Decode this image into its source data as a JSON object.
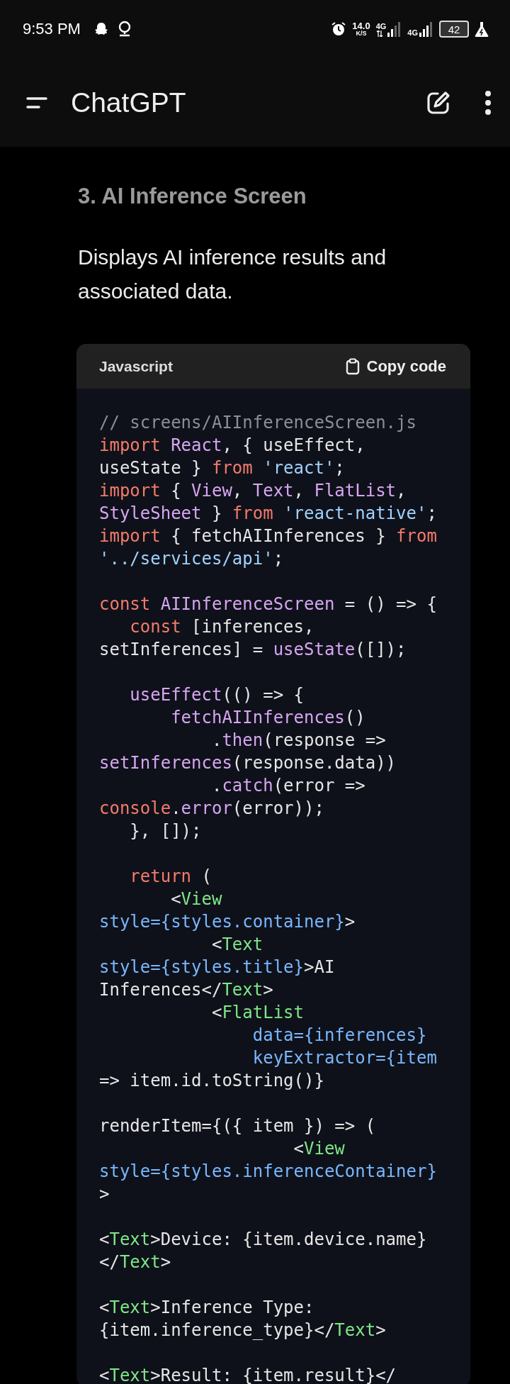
{
  "status_bar": {
    "time": "9:53 PM",
    "net_speed": "14.0",
    "net_unit": "K/S",
    "networks": [
      "4G",
      "4G"
    ],
    "battery": "42"
  },
  "app_bar": {
    "title": "ChatGPT"
  },
  "message": {
    "heading": "3. AI Inference Screen",
    "paragraph": "Displays AI inference results and associated data.",
    "code_block": {
      "language": "Javascript",
      "copy_label": "Copy code",
      "lines": [
        {
          "tokens": [
            {
              "kind": "comment",
              "text": "// screens/AIInferenceScreen.js"
            }
          ]
        },
        {
          "tokens": [
            {
              "kind": "keyword",
              "text": "import "
            },
            {
              "kind": "name",
              "text": "React"
            },
            {
              "kind": "plain",
              "text": ", { useEffect,"
            }
          ]
        },
        {
          "tokens": [
            {
              "kind": "plain",
              "text": "useState } "
            },
            {
              "kind": "keyword",
              "text": "from "
            },
            {
              "kind": "string",
              "text": "'react'"
            },
            {
              "kind": "plain",
              "text": ";"
            }
          ]
        },
        {
          "tokens": [
            {
              "kind": "keyword",
              "text": "import"
            },
            {
              "kind": "plain",
              "text": " { "
            },
            {
              "kind": "name",
              "text": "View"
            },
            {
              "kind": "plain",
              "text": ", "
            },
            {
              "kind": "name",
              "text": "Text"
            },
            {
              "kind": "plain",
              "text": ", "
            },
            {
              "kind": "name",
              "text": "FlatList"
            },
            {
              "kind": "plain",
              "text": ","
            }
          ]
        },
        {
          "tokens": [
            {
              "kind": "name",
              "text": "StyleSheet"
            },
            {
              "kind": "plain",
              "text": " } "
            },
            {
              "kind": "keyword",
              "text": "from "
            },
            {
              "kind": "string",
              "text": "'react-native'"
            },
            {
              "kind": "plain",
              "text": ";"
            }
          ]
        },
        {
          "tokens": [
            {
              "kind": "keyword",
              "text": "import"
            },
            {
              "kind": "plain",
              "text": " { fetchAIInferences } "
            },
            {
              "kind": "keyword",
              "text": "from"
            }
          ]
        },
        {
          "tokens": [
            {
              "kind": "string",
              "text": "'../services/api'"
            },
            {
              "kind": "plain",
              "text": ";"
            }
          ]
        },
        {
          "kind": "blank"
        },
        {
          "tokens": [
            {
              "kind": "keyword",
              "text": "const "
            },
            {
              "kind": "name",
              "text": "AIInferenceScreen"
            },
            {
              "kind": "plain",
              "text": " = () => {"
            }
          ]
        },
        {
          "tokens": [
            {
              "kind": "keyword",
              "text": "   const"
            },
            {
              "kind": "plain",
              "text": " [inferences,"
            }
          ]
        },
        {
          "tokens": [
            {
              "kind": "plain",
              "text": "setInferences] = "
            },
            {
              "kind": "name",
              "text": "useState"
            },
            {
              "kind": "plain",
              "text": "([]);"
            }
          ]
        },
        {
          "kind": "blank"
        },
        {
          "tokens": [
            {
              "kind": "name",
              "text": "   useEffect"
            },
            {
              "kind": "plain",
              "text": "(() => {"
            }
          ]
        },
        {
          "tokens": [
            {
              "kind": "name",
              "text": "       fetchAIInferences"
            },
            {
              "kind": "plain",
              "text": "()"
            }
          ]
        },
        {
          "tokens": [
            {
              "kind": "plain",
              "text": "           ."
            },
            {
              "kind": "name",
              "text": "then"
            },
            {
              "kind": "plain",
              "text": "(response =>"
            }
          ]
        },
        {
          "tokens": [
            {
              "kind": "name",
              "text": "setInferences"
            },
            {
              "kind": "plain",
              "text": "(response.data))"
            }
          ]
        },
        {
          "tokens": [
            {
              "kind": "plain",
              "text": "           ."
            },
            {
              "kind": "name",
              "text": "catch"
            },
            {
              "kind": "plain",
              "text": "(error =>"
            }
          ]
        },
        {
          "tokens": [
            {
              "kind": "keyword",
              "text": "console"
            },
            {
              "kind": "plain",
              "text": "."
            },
            {
              "kind": "name",
              "text": "error"
            },
            {
              "kind": "plain",
              "text": "(error));"
            }
          ]
        },
        {
          "tokens": [
            {
              "kind": "plain",
              "text": "   }, []);"
            }
          ]
        },
        {
          "kind": "blank"
        },
        {
          "tokens": [
            {
              "kind": "keyword",
              "text": "   return"
            },
            {
              "kind": "plain",
              "text": " ("
            }
          ]
        },
        {
          "tokens": [
            {
              "kind": "plain",
              "text": "       <"
            },
            {
              "kind": "tag",
              "text": "View"
            }
          ]
        },
        {
          "tokens": [
            {
              "kind": "attr",
              "text": "style={styles.container}"
            },
            {
              "kind": "plain",
              "text": ">"
            }
          ]
        },
        {
          "tokens": [
            {
              "kind": "plain",
              "text": "           <"
            },
            {
              "kind": "tag",
              "text": "Text"
            }
          ]
        },
        {
          "tokens": [
            {
              "kind": "attr",
              "text": "style={styles.title}"
            },
            {
              "kind": "plain",
              "text": ">AI"
            }
          ]
        },
        {
          "tokens": [
            {
              "kind": "plain",
              "text": "Inferences</"
            },
            {
              "kind": "tag",
              "text": "Text"
            },
            {
              "kind": "plain",
              "text": ">"
            }
          ]
        },
        {
          "tokens": [
            {
              "kind": "plain",
              "text": "           <"
            },
            {
              "kind": "tag",
              "text": "FlatList"
            }
          ]
        },
        {
          "tokens": [
            {
              "kind": "attr",
              "text": "               data={inferences}"
            }
          ]
        },
        {
          "tokens": [
            {
              "kind": "attr",
              "text": "               keyExtractor={item"
            }
          ]
        },
        {
          "tokens": [
            {
              "kind": "plain",
              "text": "=> item.id.toString()}"
            }
          ]
        },
        {
          "kind": "blank"
        },
        {
          "tokens": [
            {
              "kind": "plain",
              "text": "renderItem={({ item }) => ("
            }
          ]
        },
        {
          "tokens": [
            {
              "kind": "plain",
              "text": "                   <"
            },
            {
              "kind": "tag",
              "text": "View"
            }
          ]
        },
        {
          "tokens": [
            {
              "kind": "attr",
              "text": "style={styles.inferenceContainer}"
            }
          ]
        },
        {
          "tokens": [
            {
              "kind": "plain",
              "text": ">"
            }
          ]
        },
        {
          "kind": "blank"
        },
        {
          "tokens": [
            {
              "kind": "plain",
              "text": "<"
            },
            {
              "kind": "tag",
              "text": "Text"
            },
            {
              "kind": "plain",
              "text": ">Device: {item.device.name}"
            }
          ]
        },
        {
          "tokens": [
            {
              "kind": "plain",
              "text": "</"
            },
            {
              "kind": "tag",
              "text": "Text"
            },
            {
              "kind": "plain",
              "text": ">"
            }
          ]
        },
        {
          "kind": "blank"
        },
        {
          "tokens": [
            {
              "kind": "plain",
              "text": "<"
            },
            {
              "kind": "tag",
              "text": "Text"
            },
            {
              "kind": "plain",
              "text": ">Inference Type:"
            }
          ]
        },
        {
          "tokens": [
            {
              "kind": "plain",
              "text": "{item.inference_type}</"
            },
            {
              "kind": "tag",
              "text": "Text"
            },
            {
              "kind": "plain",
              "text": ">"
            }
          ]
        },
        {
          "kind": "blank"
        },
        {
          "tokens": [
            {
              "kind": "plain",
              "text": "<"
            },
            {
              "kind": "tag",
              "text": "Text"
            },
            {
              "kind": "plain",
              "text": ">Result: {item.result}</"
            }
          ]
        }
      ]
    }
  }
}
